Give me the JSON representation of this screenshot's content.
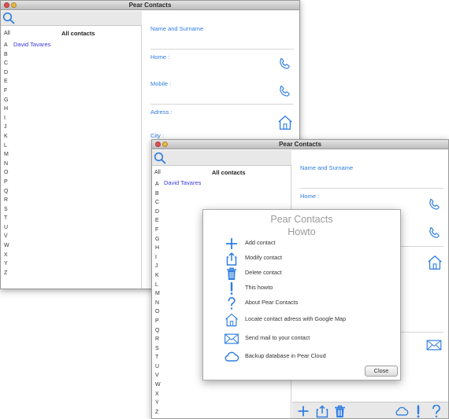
{
  "app": {
    "title": "Pear Contacts"
  },
  "colors": {
    "accent": "#2f7de1",
    "contact_name": "#3a3ae0",
    "traffic_close": "#e05050",
    "traffic_min": "#e8b840"
  },
  "list": {
    "all_label": "All",
    "header": "All contacts",
    "contacts": [
      "David Tavares"
    ],
    "letters": [
      "A",
      "B",
      "C",
      "D",
      "E",
      "F",
      "G",
      "H",
      "I",
      "J",
      "K",
      "L",
      "M",
      "N",
      "O",
      "P",
      "Q",
      "R",
      "S",
      "T",
      "U",
      "V",
      "W",
      "X",
      "Y",
      "Z"
    ]
  },
  "detail": {
    "name_label": "Name and Surname",
    "home_label": "Home :",
    "mobile_label": "Mobile :",
    "address_label": "Adress :",
    "city_label": "City :"
  },
  "icons": {
    "search": "search-icon",
    "phone": "phone-icon",
    "home": "home-icon",
    "mail": "mail-icon",
    "add": "plus-icon",
    "share": "share-icon",
    "trash": "trash-icon",
    "cloud": "cloud-icon",
    "exclaim": "exclamation-icon",
    "question": "question-icon"
  },
  "howto": {
    "title_line1": "Pear Contacts",
    "title_line2": "Howto",
    "items": [
      {
        "icon": "plus-icon",
        "label": "Add contact"
      },
      {
        "icon": "share-icon",
        "label": "Modify contact"
      },
      {
        "icon": "trash-icon",
        "label": "Delete contact"
      },
      {
        "icon": "exclamation-icon",
        "label": "This howto"
      },
      {
        "icon": "question-icon",
        "label": "About Pear Contacts"
      },
      {
        "icon": "home-icon",
        "label": "Locate contact adress with Google Map"
      },
      {
        "icon": "mail-icon",
        "label": "Send mail to your contact"
      },
      {
        "icon": "cloud-icon",
        "label": "Backup database in Pear Cloud"
      }
    ],
    "close_label": "Close"
  }
}
